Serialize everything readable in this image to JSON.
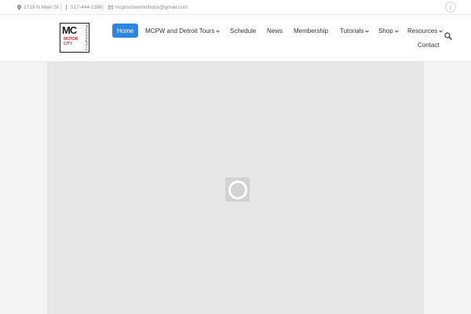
{
  "topbar": {
    "address": "1719 N Main St",
    "phone": "517-444-1386",
    "email": "mcphotoworkshops@gmail.com",
    "social_icon": "facebook-icon",
    "social_glyph": "f"
  },
  "logo": {
    "mc": "MC",
    "motor": "MOTOR",
    "city": "CITY",
    "vertical": "PHOTOGRAPHY WORKSHOPS"
  },
  "nav": {
    "home": "Home",
    "tours": "MCPW and Detroit Tours",
    "schedule": "Schedule",
    "news": "News",
    "membership": "Membership",
    "tutorials": "Tutorials",
    "shop": "Shop",
    "resources": "Resources",
    "contact": "Contact"
  },
  "colors": {
    "accent": "#2f86e0",
    "slider_bg": "#e6e6e6",
    "logo_red": "#cc3333"
  }
}
